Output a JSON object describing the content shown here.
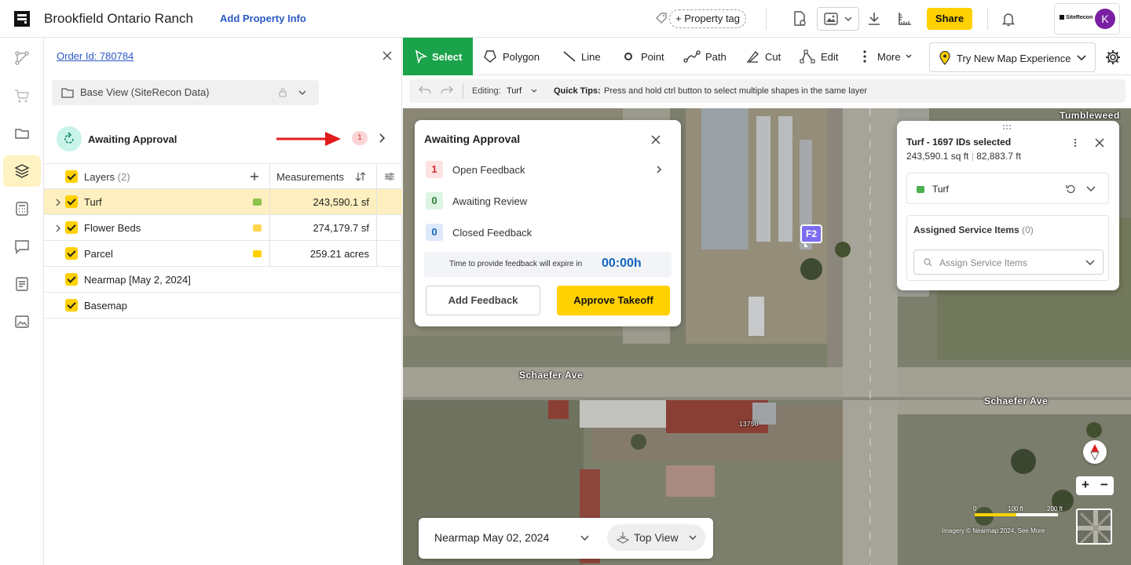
{
  "header": {
    "title": "Brookfield Ontario Ranch",
    "add_property_info": "Add Property Info",
    "property_tag": "+ Property tag",
    "share": "Share",
    "brand_text": "SiteRecon",
    "avatar_initial": "K"
  },
  "panel": {
    "order_id": "Order Id: 780784",
    "base_view": "Base View (SiteRecon Data)",
    "awaiting_label": "Awaiting Approval",
    "awaiting_count": "1",
    "layers_label": "Layers",
    "layers_count": "(2)",
    "measurements_label": "Measurements",
    "layers": [
      {
        "name": "Turf",
        "measurement": "243,590.1 sf",
        "swatch": "#8bc34a",
        "expandable": true,
        "selected": true
      },
      {
        "name": "Flower Beds",
        "measurement": "274,179.7 sf",
        "swatch": "#ffd54f",
        "expandable": true,
        "selected": false
      },
      {
        "name": "Parcel",
        "measurement": "259.21 acres",
        "swatch": "#ffd100",
        "expandable": false,
        "selected": false
      },
      {
        "name": "Nearmap [May 2, 2024]",
        "measurement": "",
        "swatch": "",
        "expandable": false,
        "selected": false
      },
      {
        "name": "Basemap",
        "measurement": "",
        "swatch": "",
        "expandable": false,
        "selected": false
      }
    ]
  },
  "toolbar": {
    "select": "Select",
    "polygon": "Polygon",
    "line": "Line",
    "point": "Point",
    "path": "Path",
    "cut": "Cut",
    "edit": "Edit",
    "more": "More",
    "new_map": "Try New Map Experience"
  },
  "subbar": {
    "editing_label": "Editing:",
    "editing_value": "Turf",
    "quick_tips_label": "Quick Tips:",
    "quick_tip": "Press and hold ctrl button to select multiple shapes in the same layer"
  },
  "awaiting_card": {
    "title": "Awaiting Approval",
    "rows": [
      {
        "count": "1",
        "label": "Open Feedback",
        "color": "#d32f2f",
        "bg": "#fde2e2"
      },
      {
        "count": "0",
        "label": "Awaiting Review",
        "color": "#2e7d32",
        "bg": "#dcf5e4"
      },
      {
        "count": "0",
        "label": "Closed Feedback",
        "color": "#1565c0",
        "bg": "#dde8fb"
      }
    ],
    "expire_text": "Time to provide feedback will expire in",
    "expire_value": "00:00h",
    "add_feedback": "Add Feedback",
    "approve": "Approve Takeoff"
  },
  "selection_card": {
    "title": "Turf - 1697 IDs selected",
    "area": "243,590.1 sq ft",
    "perimeter": "82,883.7 ft",
    "layer_name": "Turf",
    "service_items_label": "Assigned Service Items",
    "service_items_count": "(0)",
    "assign_placeholder": "Assign Service Items"
  },
  "map": {
    "marker": "F2",
    "streets": [
      "Schaefer Ave",
      "Schaefer Ave",
      "Tumbleweed",
      "13750"
    ],
    "date": "Nearmap May 02, 2024",
    "view": "Top View",
    "scale_labels": [
      "0",
      "100 ft",
      "200 ft"
    ],
    "credits": "Imagery © Nearmap 2024, See More"
  },
  "colors": {
    "accent": "#ffd100",
    "select_green": "#1aa34a",
    "link": "#2b59c3"
  }
}
